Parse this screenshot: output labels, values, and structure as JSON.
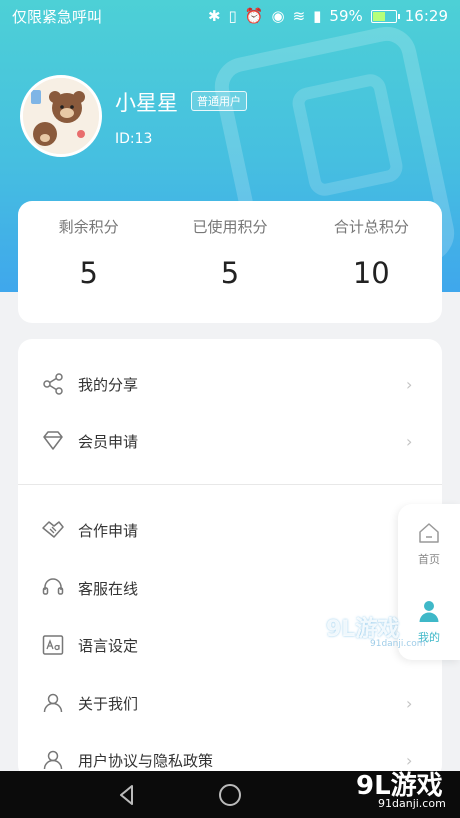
{
  "status_bar": {
    "carrier_text": "仅限紧急呼叫",
    "battery_percent": "59%",
    "battery_level": 0.59,
    "time": "16:29"
  },
  "profile": {
    "username": "小星星",
    "badge": "普通用户",
    "user_id": "ID:13"
  },
  "points": [
    {
      "label": "剩余积分",
      "value": "5"
    },
    {
      "label": "已使用积分",
      "value": "5"
    },
    {
      "label": "合计总积分",
      "value": "10"
    }
  ],
  "menu": [
    {
      "label": "我的分享",
      "icon": "share-icon"
    },
    {
      "label": "会员申请",
      "icon": "diamond-icon"
    },
    {
      "label": "合作申请",
      "icon": "handshake-icon"
    },
    {
      "label": "客服在线",
      "icon": "headset-icon"
    },
    {
      "label": "语言设定",
      "icon": "language-icon"
    },
    {
      "label": "关于我们",
      "icon": "person-icon"
    },
    {
      "label": "用户协议与隐私政策",
      "icon": "person-icon"
    }
  ],
  "side_nav": [
    {
      "label": "首页",
      "icon": "home-icon",
      "active": false
    },
    {
      "label": "我的",
      "icon": "user-icon",
      "active": true
    }
  ],
  "watermark": {
    "brand": "9L游戏",
    "site": "91danji.com"
  },
  "colors": {
    "accent": "#3fb8c8",
    "gradient_top": "#4dd0d6",
    "gradient_bottom": "#3fa7ec"
  }
}
